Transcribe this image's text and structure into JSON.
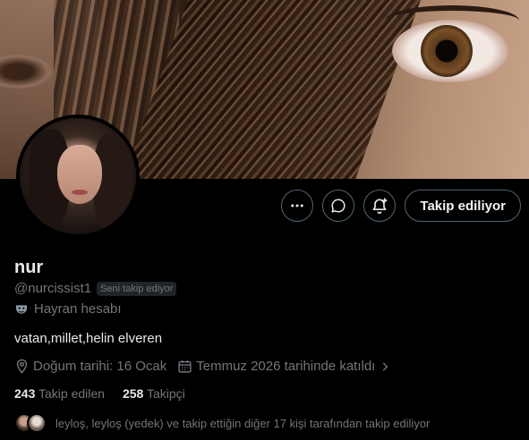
{
  "profile": {
    "name": "nur",
    "handle": "@nurcissist1",
    "follows_you_badge": "Seni takip ediyor",
    "category": "Hayran hesabı",
    "bio": "vatan,millet,helin elveren",
    "birthday": "Doğum tarihi: 16 Ocak",
    "joined": "Temmuz 2026 tarihinde katıldı",
    "following_count": "243",
    "following_label": "Takip edilen",
    "followers_count": "258",
    "followers_label": "Takipçi",
    "followed_by_text": "leyloş, leyloş (yedek) ve takip ettiğin diğer 17 kişi tarafından takip ediliyor"
  },
  "actions": {
    "more_icon": "more-dots-icon",
    "message_icon": "chat-bubble-icon",
    "notify_icon": "bell-plus-icon",
    "follow_label": "Takip ediliyor"
  },
  "icons": {
    "category": "mask-icon",
    "birthday": "location-pin-icon",
    "joined": "calendar-icon",
    "joined_chevron": "chevron-right-icon"
  },
  "colors": {
    "background": "#000000",
    "text_primary": "#e7e9ea",
    "text_secondary": "#71767b",
    "button_border": "#536471"
  }
}
